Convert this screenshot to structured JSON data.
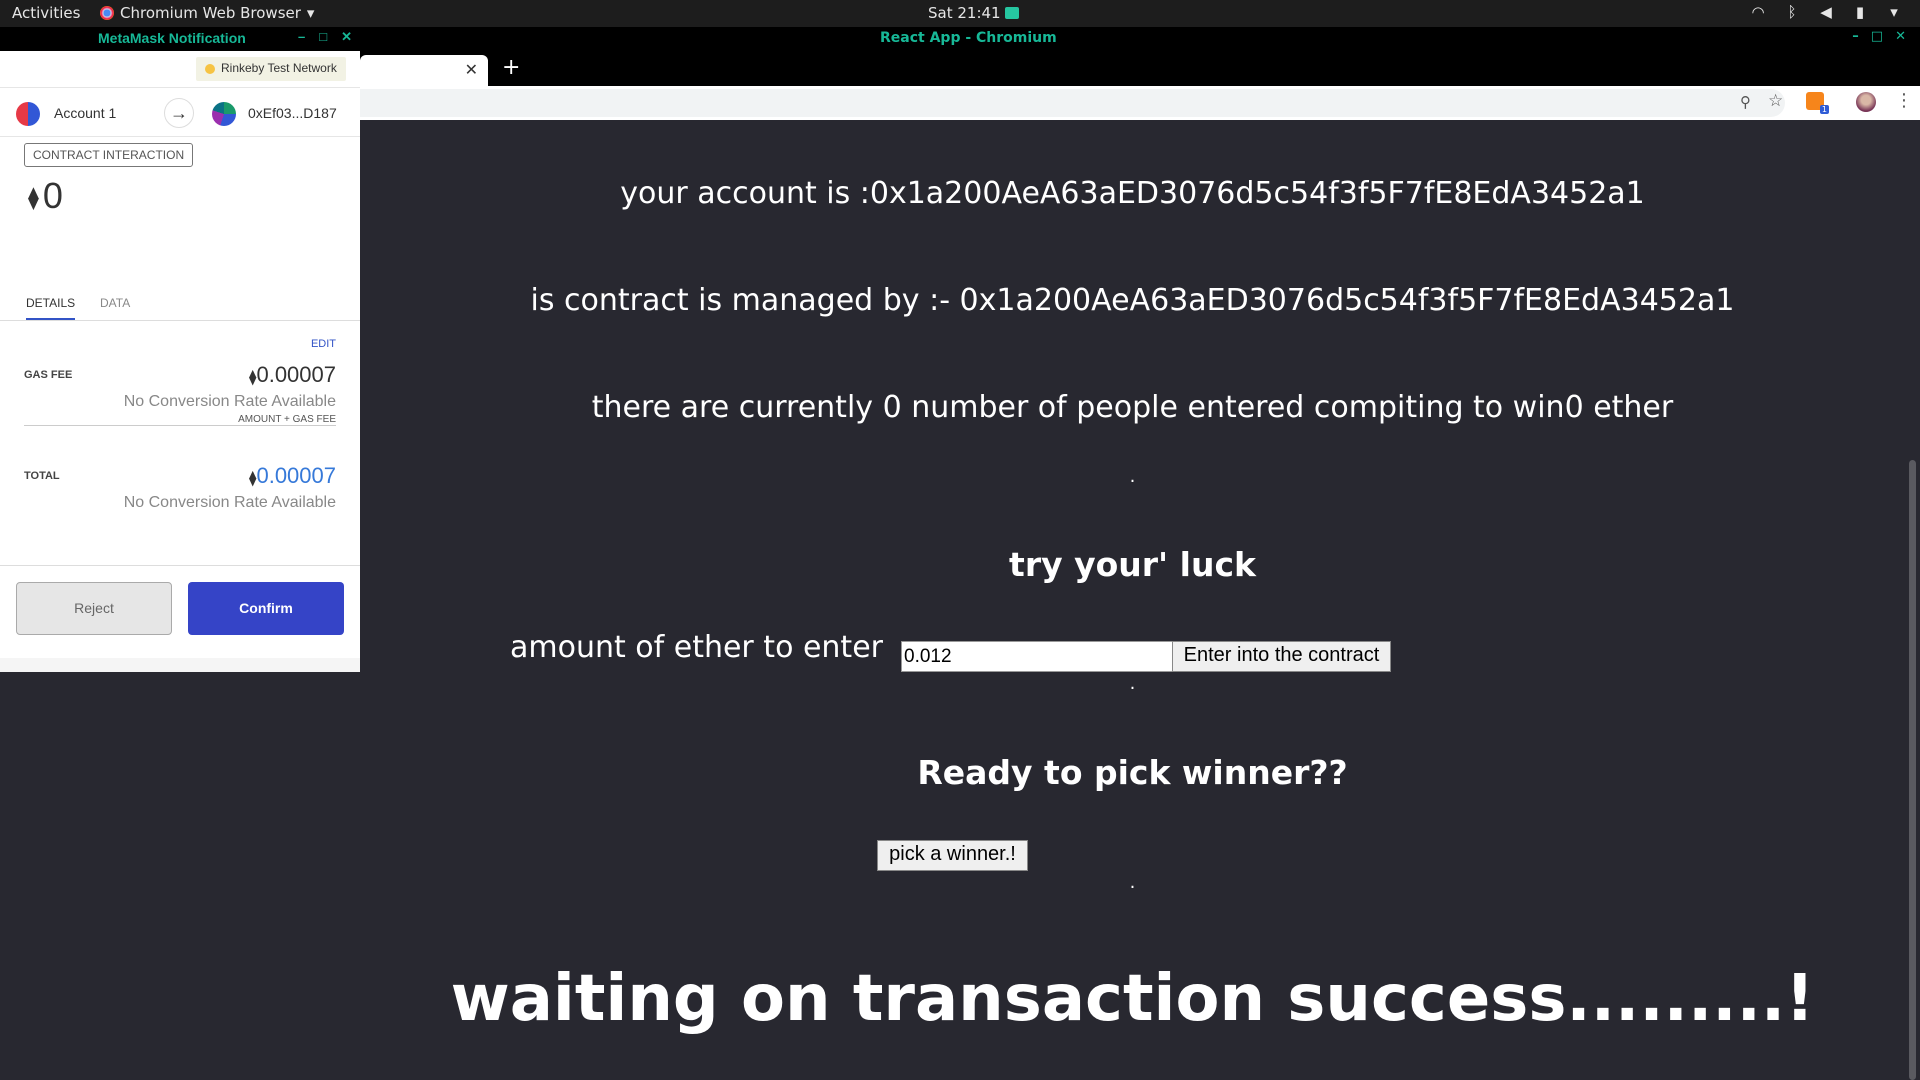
{
  "topbar": {
    "activities": "Activities",
    "app_menu": "Chromium Web Browser",
    "app_menu_arrow": "▾",
    "clock": "Sat 21:41",
    "tray_icons": [
      "wifi-icon",
      "bluetooth-icon",
      "volume-icon",
      "battery-icon",
      "system-menu-icon"
    ]
  },
  "browser": {
    "window_title": "React App - Chromium",
    "minimize": "–",
    "maximize": "□",
    "close": "✕",
    "tab_close": "✕",
    "new_tab": "+",
    "extension_badge": "1"
  },
  "page": {
    "account_line": "your account is :0x1a200AeA63aED3076d5c54f3f5F7fE8EdA3452a1",
    "manager_line": "is contract is managed by :- 0x1a200AeA63aED3076d5c54f3f5F7fE8EdA3452a1",
    "players_line": "there are currently 0 number of people entered compiting to win0 ether",
    "dot": ".",
    "try_luck_heading": "try your' luck",
    "amount_label": "amount of ether to enter",
    "amount_value": "0.012",
    "enter_button": "Enter into the contract",
    "pick_heading": "Ready to pick winner??",
    "pick_button": "pick a winner.!",
    "status_message": "waiting on transaction success.........!"
  },
  "metamask": {
    "title": "MetaMask Notification",
    "network": "Rinkeby Test Network",
    "account_name": "Account 1",
    "arrow": "→",
    "to_address": "0xEf03...D187",
    "contract_interaction": "CONTRACT INTERACTION",
    "eth_symbol": "⧫",
    "amount": "0",
    "tab_details": "DETAILS",
    "tab_data": "DATA",
    "edit": "EDIT",
    "gas_fee_label": "GAS FEE",
    "gas_fee_value": "0.00007",
    "no_conversion": "No Conversion Rate Available",
    "amount_gas_fee": "AMOUNT + GAS FEE",
    "total_label": "TOTAL",
    "total_value": "0.00007",
    "reject": "Reject",
    "confirm": "Confirm"
  }
}
